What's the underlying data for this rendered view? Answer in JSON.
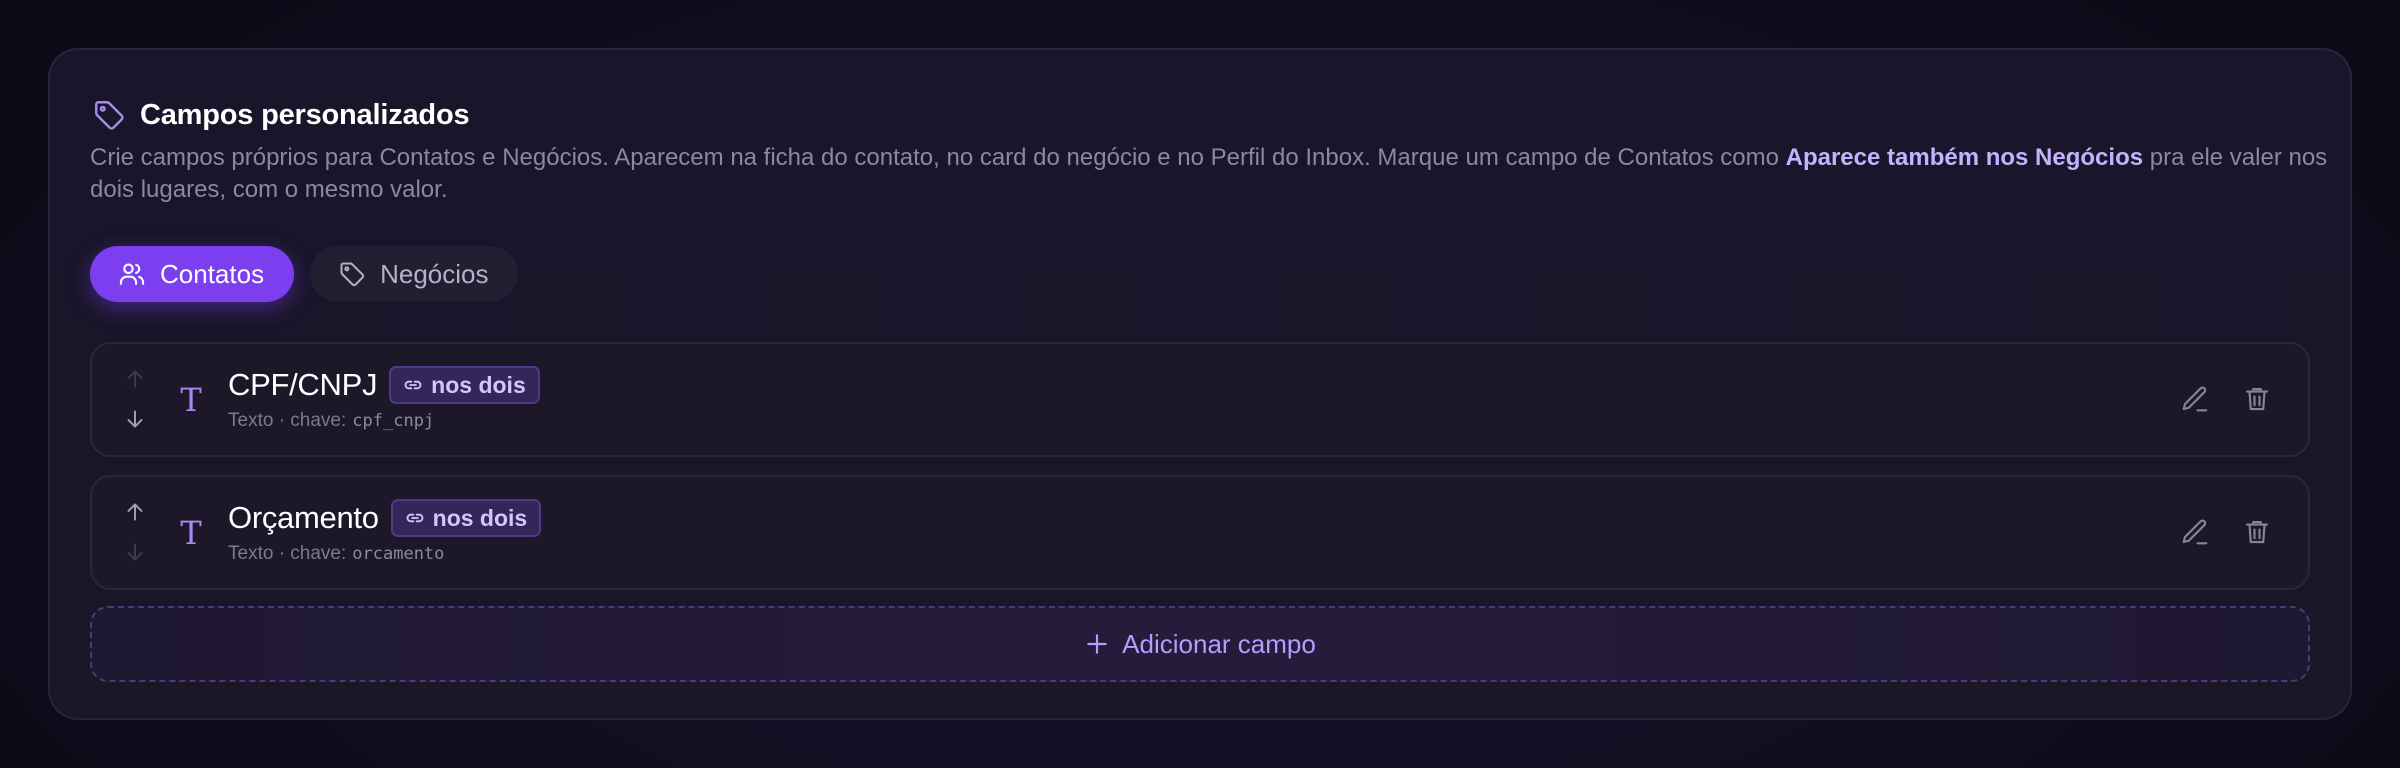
{
  "section": {
    "title": "Campos personalizados",
    "description_part1": "Crie campos próprios para Contatos e Negócios. Aparecem na ficha do contato, no card do negócio e no Perfil do Inbox. Marque um campo de Contatos como ",
    "description_highlight": "Aparece também nos Negócios",
    "description_part2": " pra ele valer nos dois lugares, com o mesmo valor."
  },
  "tabs": [
    {
      "label": "Contatos",
      "icon": "users-icon",
      "active": true
    },
    {
      "label": "Negócios",
      "icon": "tag-icon",
      "active": false
    }
  ],
  "fields": [
    {
      "name": "CPF/CNPJ",
      "badge": "nos dois",
      "type_label": "Texto · chave:",
      "key": "cpf_cnpj",
      "can_move_up": false,
      "can_move_down": true
    },
    {
      "name": "Orçamento",
      "badge": "nos dois",
      "type_label": "Texto · chave:",
      "key": "orcamento",
      "can_move_up": true,
      "can_move_down": false
    }
  ],
  "add_button": {
    "label": "Adicionar campo"
  },
  "colors": {
    "accent": "#7b3ff0",
    "highlight": "#c5b1ff",
    "badge_bg": "#352659"
  }
}
